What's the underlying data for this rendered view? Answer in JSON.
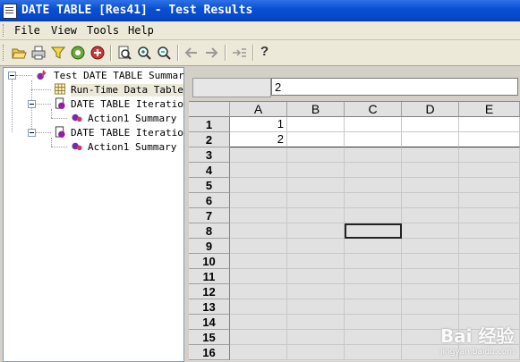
{
  "window": {
    "title": "DATE TABLE [Res41] - Test Results"
  },
  "menu": [
    {
      "label": "File"
    },
    {
      "label": "View"
    },
    {
      "label": "Tools"
    },
    {
      "label": "Help"
    }
  ],
  "toolbar": {
    "icons": [
      "open-icon",
      "print-icon",
      "filter-icon",
      "find-icon",
      "add-icon",
      "report-icon",
      "zoom-in-icon",
      "zoom-out-icon",
      "back-icon",
      "forward-icon",
      "step-icon",
      "help-icon"
    ],
    "help_label": "?"
  },
  "tree": {
    "nodes": [
      {
        "label": "Test DATE TABLE Summary",
        "icon": "test-summary-icon"
      },
      {
        "label": "Run-Time Data Table",
        "icon": "data-table-icon"
      },
      {
        "label": "DATE TABLE Iteration",
        "icon": "iteration-icon"
      },
      {
        "label": "Action1 Summary",
        "icon": "action-summary-icon"
      },
      {
        "label": "DATE TABLE Iteration",
        "icon": "iteration-icon"
      },
      {
        "label": "Action1 Summary",
        "icon": "action-summary-icon"
      }
    ]
  },
  "sheet": {
    "formula_value": "2",
    "columns": [
      "A",
      "B",
      "C",
      "D",
      "E"
    ],
    "rows": [
      "1",
      "2",
      "3",
      "4",
      "5",
      "6",
      "7",
      "8",
      "9",
      "10",
      "11",
      "12",
      "13",
      "14",
      "15",
      "16"
    ],
    "cells": {
      "A1": "1",
      "A2": "2"
    },
    "selected_cell": "C8"
  },
  "watermark": {
    "text": "Bai 经验",
    "sub": "jingyan.baidu.com"
  }
}
